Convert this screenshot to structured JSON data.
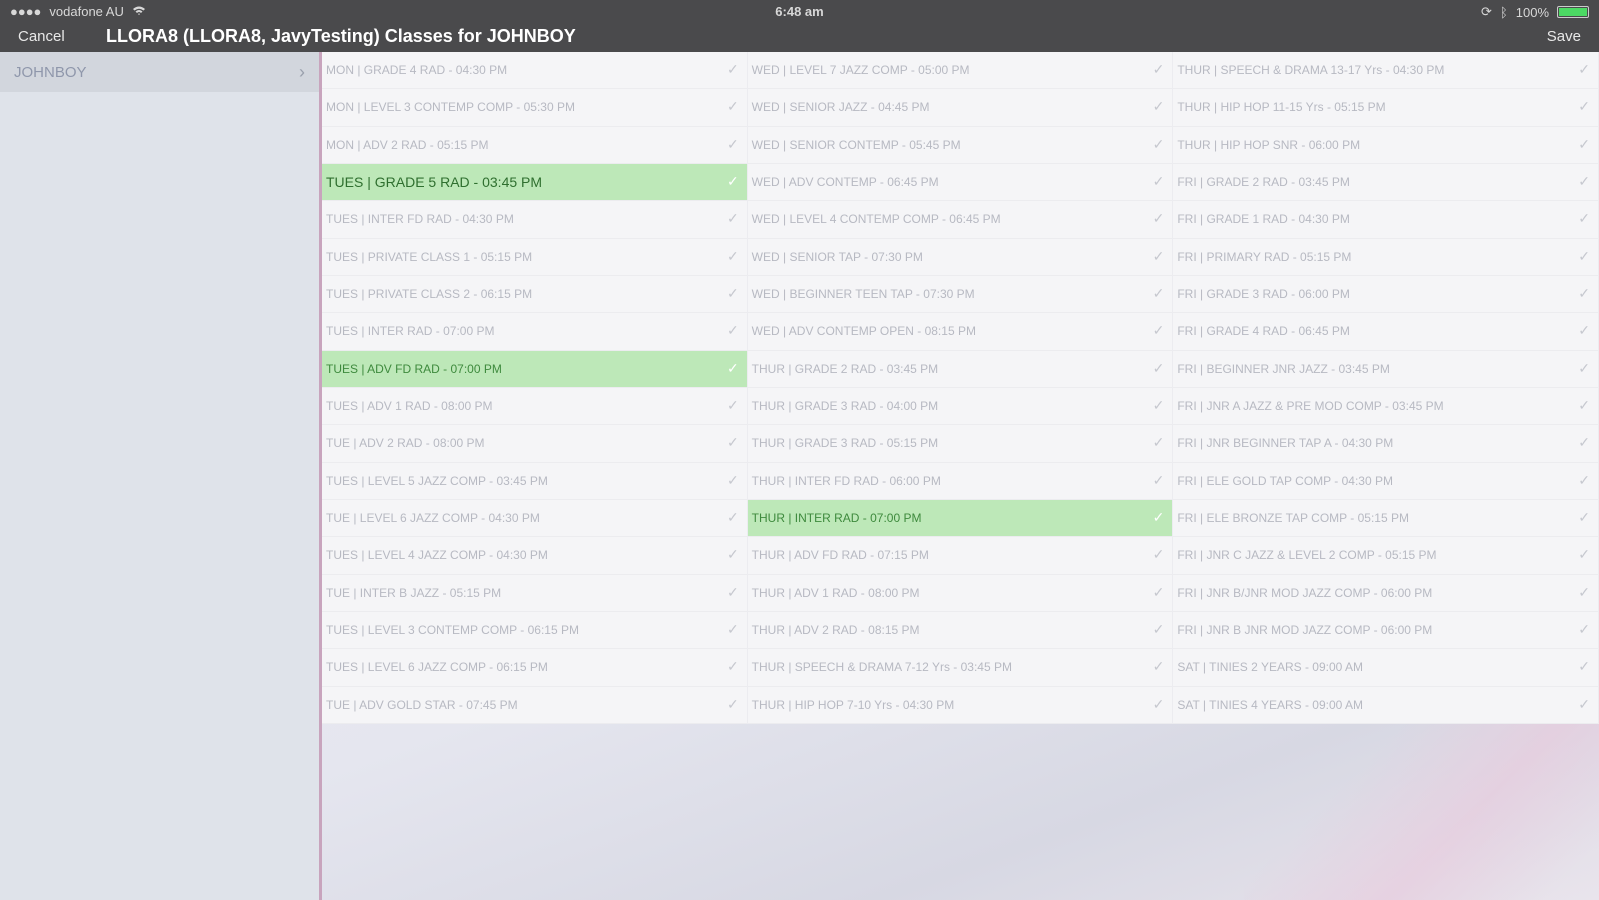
{
  "status_bar": {
    "signal": "●●●●",
    "carrier": "vodafone AU",
    "wifi_icon": "wifi-icon",
    "time": "6:48 am",
    "battery_percent": "100%",
    "battery_level": 1.0
  },
  "nav": {
    "cancel": "Cancel",
    "title": "LLORA8 (LLORA8, JavyTesting) Classes for JOHNBOY",
    "save": "Save"
  },
  "sidebar": {
    "items": [
      {
        "label": "JOHNBOY"
      }
    ]
  },
  "columns": [
    {
      "cells": [
        {
          "label": "MON | GRADE 4 RAD - 04:30 PM",
          "selected": false
        },
        {
          "label": "MON | LEVEL 3 CONTEMP COMP - 05:30 PM",
          "selected": false
        },
        {
          "label": "MON | ADV 2 RAD - 05:15 PM",
          "selected": false
        },
        {
          "label": "TUES | GRADE 5 RAD - 03:45 PM",
          "selected": true
        },
        {
          "label": "TUES | INTER FD RAD - 04:30 PM",
          "selected": false
        },
        {
          "label": "TUES | PRIVATE CLASS 1 - 05:15 PM",
          "selected": false
        },
        {
          "label": "TUES | PRIVATE CLASS 2 - 06:15 PM",
          "selected": false
        },
        {
          "label": "TUES | INTER RAD - 07:00 PM",
          "selected": false
        },
        {
          "label": "TUES | ADV FD RAD - 07:00 PM",
          "selected": true
        },
        {
          "label": "TUES | ADV 1 RAD - 08:00 PM",
          "selected": false
        },
        {
          "label": "TUE | ADV 2 RAD - 08:00 PM",
          "selected": false
        },
        {
          "label": "TUES | LEVEL 5 JAZZ COMP - 03:45 PM",
          "selected": false
        },
        {
          "label": "TUE | LEVEL 6 JAZZ COMP - 04:30 PM",
          "selected": false
        },
        {
          "label": "TUES | LEVEL 4 JAZZ COMP - 04:30 PM",
          "selected": false
        },
        {
          "label": "TUE | INTER B JAZZ - 05:15 PM",
          "selected": false
        },
        {
          "label": "TUES | LEVEL 3 CONTEMP COMP - 06:15 PM",
          "selected": false
        },
        {
          "label": "TUES | LEVEL 6 JAZZ COMP - 06:15 PM",
          "selected": false
        },
        {
          "label": "TUE | ADV GOLD STAR - 07:45 PM",
          "selected": false
        }
      ]
    },
    {
      "cells": [
        {
          "label": "WED | LEVEL 7 JAZZ COMP - 05:00 PM",
          "selected": false
        },
        {
          "label": "WED | SENIOR JAZZ - 04:45 PM",
          "selected": false
        },
        {
          "label": "WED | SENIOR CONTEMP - 05:45 PM",
          "selected": false
        },
        {
          "label": "WED | ADV CONTEMP - 06:45 PM",
          "selected": false
        },
        {
          "label": "WED | LEVEL 4 CONTEMP COMP - 06:45 PM",
          "selected": false
        },
        {
          "label": "WED | SENIOR TAP - 07:30 PM",
          "selected": false
        },
        {
          "label": "WED | BEGINNER TEEN TAP - 07:30 PM",
          "selected": false
        },
        {
          "label": "WED | ADV CONTEMP OPEN - 08:15 PM",
          "selected": false
        },
        {
          "label": "THUR | GRADE 2 RAD - 03:45 PM",
          "selected": false
        },
        {
          "label": "THUR | GRADE 3 RAD - 04:00 PM",
          "selected": false
        },
        {
          "label": "THUR | GRADE 3 RAD - 05:15 PM",
          "selected": false
        },
        {
          "label": "THUR | INTER FD RAD - 06:00 PM",
          "selected": false
        },
        {
          "label": "THUR | INTER RAD - 07:00 PM",
          "selected": true
        },
        {
          "label": "THUR | ADV FD RAD - 07:15 PM",
          "selected": false
        },
        {
          "label": "THUR | ADV 1 RAD - 08:00 PM",
          "selected": false
        },
        {
          "label": "THUR | ADV 2 RAD - 08:15 PM",
          "selected": false
        },
        {
          "label": "THUR | SPEECH & DRAMA 7-12 Yrs - 03:45 PM",
          "selected": false
        },
        {
          "label": "THUR | HIP HOP 7-10 Yrs - 04:30 PM",
          "selected": false
        }
      ]
    },
    {
      "cells": [
        {
          "label": "THUR | SPEECH & DRAMA 13-17 Yrs - 04:30 PM",
          "selected": false
        },
        {
          "label": "THUR | HIP HOP 11-15 Yrs - 05:15 PM",
          "selected": false
        },
        {
          "label": "THUR | HIP HOP SNR - 06:00 PM",
          "selected": false
        },
        {
          "label": "FRI | GRADE 2 RAD - 03:45 PM",
          "selected": false
        },
        {
          "label": "FRI | GRADE 1 RAD - 04:30 PM",
          "selected": false
        },
        {
          "label": "FRI | PRIMARY RAD - 05:15 PM",
          "selected": false
        },
        {
          "label": "FRI | GRADE 3 RAD - 06:00 PM",
          "selected": false
        },
        {
          "label": "FRI | GRADE 4 RAD - 06:45 PM",
          "selected": false
        },
        {
          "label": "FRI | BEGINNER JNR JAZZ - 03:45 PM",
          "selected": false
        },
        {
          "label": "FRI | JNR A JAZZ & PRE MOD COMP - 03:45 PM",
          "selected": false
        },
        {
          "label": "FRI | JNR BEGINNER TAP A - 04:30 PM",
          "selected": false
        },
        {
          "label": "FRI | ELE GOLD TAP COMP - 04:30 PM",
          "selected": false
        },
        {
          "label": "FRI | ELE BRONZE TAP COMP - 05:15 PM",
          "selected": false
        },
        {
          "label": "FRI | JNR C JAZZ & LEVEL 2 COMP - 05:15 PM",
          "selected": false
        },
        {
          "label": "FRI | JNR B/JNR MOD JAZZ COMP - 06:00 PM",
          "selected": false
        },
        {
          "label": "FRI | JNR B JNR MOD JAZZ COMP - 06:00 PM",
          "selected": false
        },
        {
          "label": "SAT | TINIES 2 YEARS - 09:00 AM",
          "selected": false
        },
        {
          "label": "SAT | TINIES 4 YEARS - 09:00 AM",
          "selected": false
        }
      ]
    }
  ],
  "colors": {
    "bar": "#4a4a4c",
    "selected_bg": "#bde8b8",
    "selected_text": "#3e8a3d",
    "sidebar_bg": "#dfe3ea"
  }
}
